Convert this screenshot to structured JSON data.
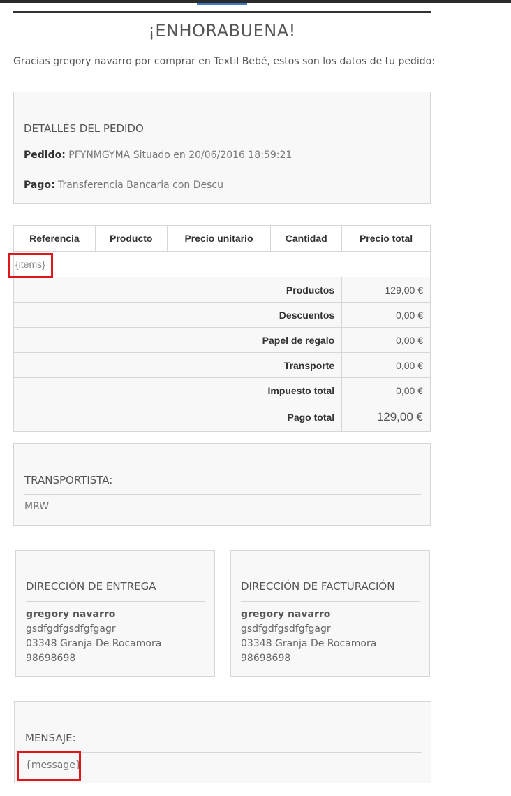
{
  "heading": "¡ENHORABUENA!",
  "intro": "Gracias gregory navarro por comprar en Textil Bebé, estos son los datos de tu pedido:",
  "order": {
    "title": "DETALLES DEL PEDIDO",
    "order_label": "Pedido:",
    "order_value": "PFYNMGYMA Situado en 20/06/2016 18:59:21",
    "payment_label": "Pago:",
    "payment_value": "Transferencia Bancaria con Descu"
  },
  "table": {
    "headers": [
      "Referencia",
      "Producto",
      "Precio unitario",
      "Cantidad",
      "Precio total"
    ],
    "items_placeholder": "{items}",
    "summary": [
      {
        "label": "Productos",
        "value": "129,00 €"
      },
      {
        "label": "Descuentos",
        "value": "0,00 €"
      },
      {
        "label": "Papel de regalo",
        "value": "0,00 €"
      },
      {
        "label": "Transporte",
        "value": "0,00 €"
      },
      {
        "label": "Impuesto total",
        "value": "0,00 €"
      }
    ],
    "total_label": "Pago total",
    "total_value": "129,00 €"
  },
  "carrier": {
    "title": "TRANSPORTISTA:",
    "value": "MRW"
  },
  "delivery": {
    "title": "DIRECCIÓN DE ENTREGA",
    "name": "gregory navarro",
    "line1": "gsdfgdfgsdfgfgagr",
    "line2": "03348 Granja De Rocamora",
    "phone": "98698698"
  },
  "billing": {
    "title": "DIRECCIÓN DE FACTURACIÓN",
    "name": "gregory navarro",
    "line1": "gsdfgdfgsdfgfgagr",
    "line2": "03348 Granja De Rocamora",
    "phone": "98698698"
  },
  "message": {
    "title": "MENSAJE:",
    "placeholder": "{message}"
  },
  "colors": {
    "highlight": "#e0161d",
    "rule": "#333333"
  }
}
